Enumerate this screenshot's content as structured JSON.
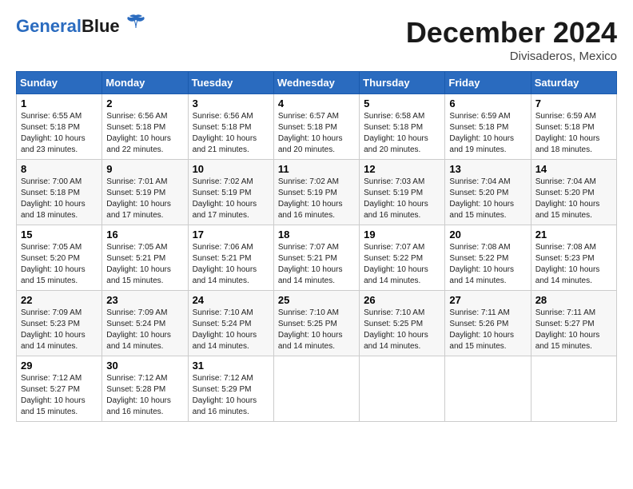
{
  "logo": {
    "part1": "General",
    "part2": "Blue"
  },
  "header": {
    "month": "December 2024",
    "location": "Divisaderos, Mexico"
  },
  "days_of_week": [
    "Sunday",
    "Monday",
    "Tuesday",
    "Wednesday",
    "Thursday",
    "Friday",
    "Saturday"
  ],
  "weeks": [
    [
      {
        "day": "1",
        "info": "Sunrise: 6:55 AM\nSunset: 5:18 PM\nDaylight: 10 hours\nand 23 minutes."
      },
      {
        "day": "2",
        "info": "Sunrise: 6:56 AM\nSunset: 5:18 PM\nDaylight: 10 hours\nand 22 minutes."
      },
      {
        "day": "3",
        "info": "Sunrise: 6:56 AM\nSunset: 5:18 PM\nDaylight: 10 hours\nand 21 minutes."
      },
      {
        "day": "4",
        "info": "Sunrise: 6:57 AM\nSunset: 5:18 PM\nDaylight: 10 hours\nand 20 minutes."
      },
      {
        "day": "5",
        "info": "Sunrise: 6:58 AM\nSunset: 5:18 PM\nDaylight: 10 hours\nand 20 minutes."
      },
      {
        "day": "6",
        "info": "Sunrise: 6:59 AM\nSunset: 5:18 PM\nDaylight: 10 hours\nand 19 minutes."
      },
      {
        "day": "7",
        "info": "Sunrise: 6:59 AM\nSunset: 5:18 PM\nDaylight: 10 hours\nand 18 minutes."
      }
    ],
    [
      {
        "day": "8",
        "info": "Sunrise: 7:00 AM\nSunset: 5:18 PM\nDaylight: 10 hours\nand 18 minutes."
      },
      {
        "day": "9",
        "info": "Sunrise: 7:01 AM\nSunset: 5:19 PM\nDaylight: 10 hours\nand 17 minutes."
      },
      {
        "day": "10",
        "info": "Sunrise: 7:02 AM\nSunset: 5:19 PM\nDaylight: 10 hours\nand 17 minutes."
      },
      {
        "day": "11",
        "info": "Sunrise: 7:02 AM\nSunset: 5:19 PM\nDaylight: 10 hours\nand 16 minutes."
      },
      {
        "day": "12",
        "info": "Sunrise: 7:03 AM\nSunset: 5:19 PM\nDaylight: 10 hours\nand 16 minutes."
      },
      {
        "day": "13",
        "info": "Sunrise: 7:04 AM\nSunset: 5:20 PM\nDaylight: 10 hours\nand 15 minutes."
      },
      {
        "day": "14",
        "info": "Sunrise: 7:04 AM\nSunset: 5:20 PM\nDaylight: 10 hours\nand 15 minutes."
      }
    ],
    [
      {
        "day": "15",
        "info": "Sunrise: 7:05 AM\nSunset: 5:20 PM\nDaylight: 10 hours\nand 15 minutes."
      },
      {
        "day": "16",
        "info": "Sunrise: 7:05 AM\nSunset: 5:21 PM\nDaylight: 10 hours\nand 15 minutes."
      },
      {
        "day": "17",
        "info": "Sunrise: 7:06 AM\nSunset: 5:21 PM\nDaylight: 10 hours\nand 14 minutes."
      },
      {
        "day": "18",
        "info": "Sunrise: 7:07 AM\nSunset: 5:21 PM\nDaylight: 10 hours\nand 14 minutes."
      },
      {
        "day": "19",
        "info": "Sunrise: 7:07 AM\nSunset: 5:22 PM\nDaylight: 10 hours\nand 14 minutes."
      },
      {
        "day": "20",
        "info": "Sunrise: 7:08 AM\nSunset: 5:22 PM\nDaylight: 10 hours\nand 14 minutes."
      },
      {
        "day": "21",
        "info": "Sunrise: 7:08 AM\nSunset: 5:23 PM\nDaylight: 10 hours\nand 14 minutes."
      }
    ],
    [
      {
        "day": "22",
        "info": "Sunrise: 7:09 AM\nSunset: 5:23 PM\nDaylight: 10 hours\nand 14 minutes."
      },
      {
        "day": "23",
        "info": "Sunrise: 7:09 AM\nSunset: 5:24 PM\nDaylight: 10 hours\nand 14 minutes."
      },
      {
        "day": "24",
        "info": "Sunrise: 7:10 AM\nSunset: 5:24 PM\nDaylight: 10 hours\nand 14 minutes."
      },
      {
        "day": "25",
        "info": "Sunrise: 7:10 AM\nSunset: 5:25 PM\nDaylight: 10 hours\nand 14 minutes."
      },
      {
        "day": "26",
        "info": "Sunrise: 7:10 AM\nSunset: 5:25 PM\nDaylight: 10 hours\nand 14 minutes."
      },
      {
        "day": "27",
        "info": "Sunrise: 7:11 AM\nSunset: 5:26 PM\nDaylight: 10 hours\nand 15 minutes."
      },
      {
        "day": "28",
        "info": "Sunrise: 7:11 AM\nSunset: 5:27 PM\nDaylight: 10 hours\nand 15 minutes."
      }
    ],
    [
      {
        "day": "29",
        "info": "Sunrise: 7:12 AM\nSunset: 5:27 PM\nDaylight: 10 hours\nand 15 minutes."
      },
      {
        "day": "30",
        "info": "Sunrise: 7:12 AM\nSunset: 5:28 PM\nDaylight: 10 hours\nand 16 minutes."
      },
      {
        "day": "31",
        "info": "Sunrise: 7:12 AM\nSunset: 5:29 PM\nDaylight: 10 hours\nand 16 minutes."
      },
      {
        "day": "",
        "info": ""
      },
      {
        "day": "",
        "info": ""
      },
      {
        "day": "",
        "info": ""
      },
      {
        "day": "",
        "info": ""
      }
    ]
  ]
}
